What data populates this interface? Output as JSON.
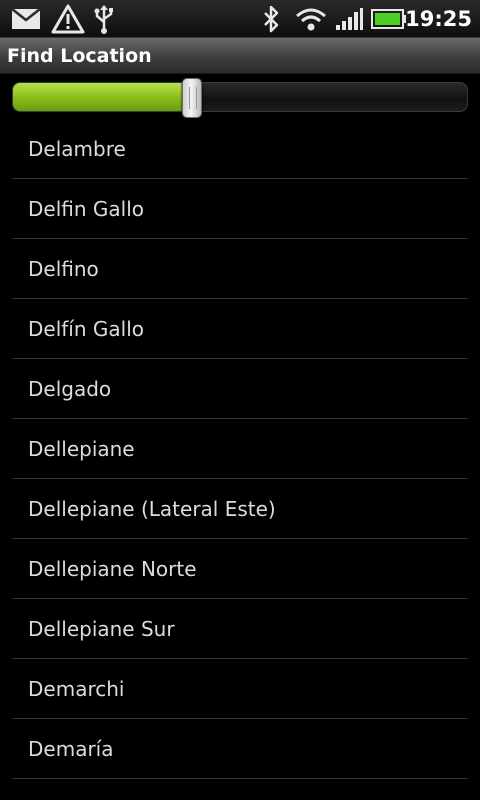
{
  "status_bar": {
    "time": "19:25",
    "icons": [
      "mail-icon",
      "warning-icon",
      "usb-icon",
      "bluetooth-icon",
      "wifi-icon",
      "signal-icon",
      "battery-icon"
    ],
    "battery_color": "#4cd023"
  },
  "title_bar": {
    "title": "Find Location"
  },
  "slider": {
    "value_percent": 40,
    "fill_color": "#8cc11d"
  },
  "locations": [
    "Delambre",
    "Delfin Gallo",
    "Delfino",
    "Delfín Gallo",
    "Delgado",
    "Dellepiane",
    "Dellepiane (Lateral Este)",
    "Dellepiane Norte",
    "Dellepiane Sur",
    "Demarchi",
    "Demaría"
  ]
}
